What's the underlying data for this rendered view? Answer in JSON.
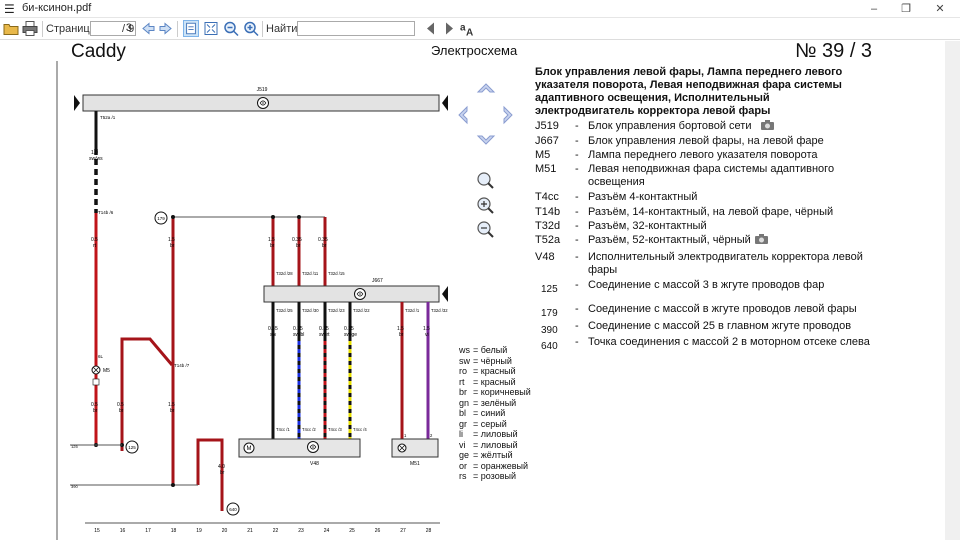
{
  "window": {
    "title": "би-ксинон.pdf",
    "minimize": "–",
    "maximize": "❐",
    "close": "✕"
  },
  "toolbar": {
    "page_label": "Страница:",
    "page_value": "3",
    "page_total": "/ 9",
    "find_label": "Найти:",
    "find_value": ""
  },
  "document": {
    "brand": "Caddy",
    "section": "Электросхема",
    "number": "№  39 / 3",
    "legend_title": "Блок управления левой фары, Лампа переднего левого указателя поворота, Левая неподвижная фара системы адаптивного освещения, Исполнительный электродвигатель корректора левой фары",
    "legend": [
      {
        "code": "J519",
        "desc": "Блок управления бортовой сети",
        "camera": true
      },
      {
        "code": "J667",
        "desc": "Блок управления левой фары, на левой фаре",
        "camera": false
      },
      {
        "code": "M5",
        "desc": "Лампа переднего левого указателя поворота",
        "camera": false
      },
      {
        "code": "M51",
        "desc": "Левая неподвижная фара системы адаптивного освещения",
        "camera": false
      },
      {
        "code": "T4cc",
        "desc": "Разъём 4-контактный",
        "camera": false
      },
      {
        "code": "T14b",
        "desc": "Разъём, 14-контактный, на левой фаре, чёрный",
        "camera": false
      },
      {
        "code": "T32d",
        "desc": "Разъём, 32-контактный",
        "camera": false
      },
      {
        "code": "T52a",
        "desc": "Разъём, 52-контактный, чёрный",
        "camera": true
      },
      {
        "code": "V48",
        "desc": "Исполнительный электродвигатель корректора левой фары",
        "camera": false
      },
      {
        "code": "125",
        "desc": "Соединение с массой 3 в жгуте проводов фар",
        "camera": false
      },
      {
        "code": "179",
        "desc": "Соединение с массой в жгуте проводов левой фары",
        "camera": false
      },
      {
        "code": "390",
        "desc": "Соединение с массой 25 в главном жгуте проводов",
        "camera": false
      },
      {
        "code": "640",
        "desc": "Точка соединения с массой 2 в моторном отсеке слева",
        "camera": false
      }
    ],
    "wire_colors": [
      {
        "code": "ws",
        "name": "белый"
      },
      {
        "code": "sw",
        "name": "чёрный"
      },
      {
        "code": "ro",
        "name": "красный"
      },
      {
        "code": "rt",
        "name": "красный"
      },
      {
        "code": "br",
        "name": "коричневый"
      },
      {
        "code": "gn",
        "name": "зелёный"
      },
      {
        "code": "bl",
        "name": "синий"
      },
      {
        "code": "gr",
        "name": "серый"
      },
      {
        "code": "li",
        "name": "лиловый"
      },
      {
        "code": "vi",
        "name": "лиловый"
      },
      {
        "code": "ge",
        "name": "жёлтый"
      },
      {
        "code": "or",
        "name": "оранжевый"
      },
      {
        "code": "rs",
        "name": "розовый"
      }
    ],
    "diagram": {
      "j519_label": "J519",
      "j667_label": "J667",
      "v48_label": "V48",
      "m51_label": "M51",
      "m5_label": "M5",
      "t52a_pin": "T52a /1",
      "wire1_spec": "1.0",
      "wire1_color": "sw/ws",
      "t14b_top": "T14b /6",
      "t14b_mid": "T14b /7",
      "grounds": [
        "179",
        "125",
        "640"
      ],
      "bottom_numbers": [
        "15",
        "16",
        "17",
        "18",
        "19",
        "20",
        "21",
        "22",
        "23",
        "24",
        "25",
        "26",
        "27",
        "28"
      ],
      "side_labels": [
        "125",
        "390"
      ],
      "mid_label": "6L",
      "j667_top_wires": [
        {
          "pin": "T32d /28",
          "size": "1.5",
          "color": "br"
        },
        {
          "pin": "T32d /11",
          "size": "0.35",
          "color": "br"
        },
        {
          "pin": "T32d /15",
          "size": "0.35",
          "color": "br"
        }
      ],
      "j667_bottom_wires": [
        {
          "pin": "T32d /25",
          "size": "0.35",
          "color": "sw"
        },
        {
          "pin": "T32d /30",
          "size": "0.35",
          "color": "sw/bl"
        },
        {
          "pin": "T32d /23",
          "size": "0.35",
          "color": "sw/rt"
        },
        {
          "pin": "T32d /22",
          "size": "0.35",
          "color": "sw/ge"
        },
        {
          "pin": "T32d /1",
          "size": "1.5",
          "color": "br"
        },
        {
          "pin": "T32d /32",
          "size": "1.5",
          "color": "vi"
        }
      ],
      "left_wires": [
        {
          "size": "0.5",
          "color": "rt"
        },
        {
          "size": "1.5",
          "color": "br"
        },
        {
          "size": "0.5",
          "color": "br"
        },
        {
          "size": "0.5",
          "color": "br"
        },
        {
          "size": "1.5",
          "color": "br"
        },
        {
          "size": "4.0",
          "color": "br"
        }
      ],
      "v48_pins": [
        "T4cc /1",
        "T4cc /2",
        "T4cc /3",
        "T4cc /4"
      ],
      "m51_pins": [
        "1",
        "2"
      ]
    }
  },
  "colors": {
    "red": "#c0141a",
    "brown_red": "#a5141a",
    "blue": "#1a2fe0",
    "purple": "#7a2a9a",
    "yellow": "#e8e000",
    "grey_bar": "#e0e0e0"
  }
}
